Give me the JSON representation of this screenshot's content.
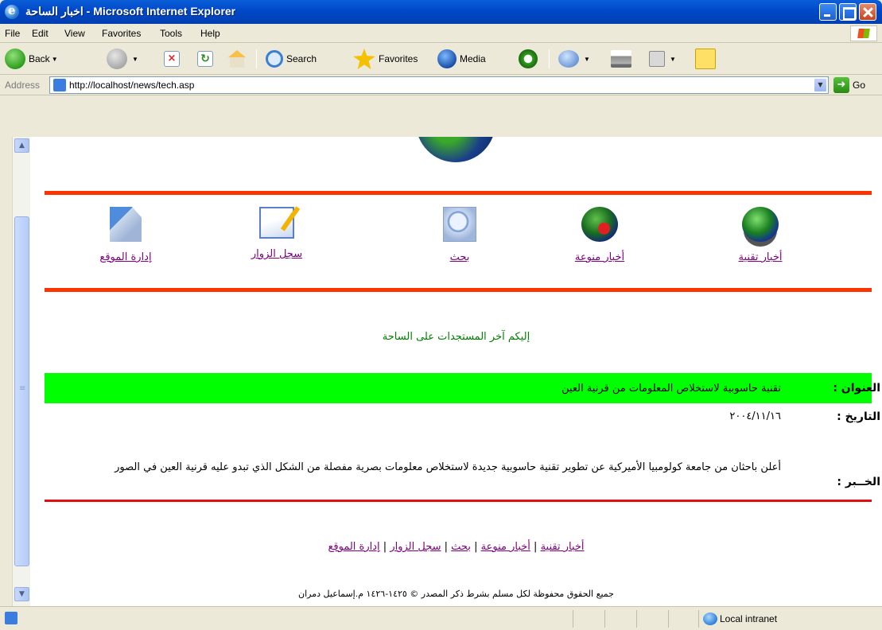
{
  "window": {
    "title": "اخبار الساحة - Microsoft Internet Explorer"
  },
  "menu": [
    "File",
    "Edit",
    "View",
    "Favorites",
    "Tools",
    "Help"
  ],
  "toolbar": {
    "back_label": "Back",
    "search_label": "Search",
    "favorites_label": "Favorites",
    "media_label": "Media"
  },
  "address": {
    "label": "Address",
    "url": "http://localhost/news/tech.asp",
    "go_label": "Go"
  },
  "page": {
    "nav": [
      {
        "label": "أخبار تقنية",
        "icon": "globe-stack-icon"
      },
      {
        "label": "أخبار منوعة",
        "icon": "globe-icon"
      },
      {
        "label": "بحث",
        "icon": "magnifier-icon"
      },
      {
        "label": "سجل الزوار",
        "icon": "guestbook-icon"
      },
      {
        "label": "إدارة الموقع",
        "icon": "admin-tools-icon"
      }
    ],
    "welcome": "إليكم آخر المستجدات على الساحة",
    "article": {
      "title_label": "العنوان :",
      "title": "تقنية حاسوبية لاستخلاص المعلومات من قرنية العين",
      "date_label": "التاريخ :",
      "date": "٢٠٠٤/١١/١٦",
      "news_label": "الخــبر :",
      "body": "أعلن باحثان من جامعة كولومبيا الأميركية عن تطوير تقنية حاسوبية جديدة لاستخلاص معلومات بصرية مفصلة من الشكل الذي تبدو عليه قرنية العين في الصور"
    },
    "footer_links": [
      "أخبار تقنية",
      "أخبار منوعة",
      "بحث",
      "سجل الزوار",
      "إدارة الموقع"
    ],
    "footer_separator": "|",
    "copyright": "جميع الحقوق محفوظة لكل مسلم بشرط ذكر المصدر © ١٤٢٥-١٤٢٦ م.إسماعيل دمران"
  },
  "status": {
    "zone": "Local intranet"
  }
}
